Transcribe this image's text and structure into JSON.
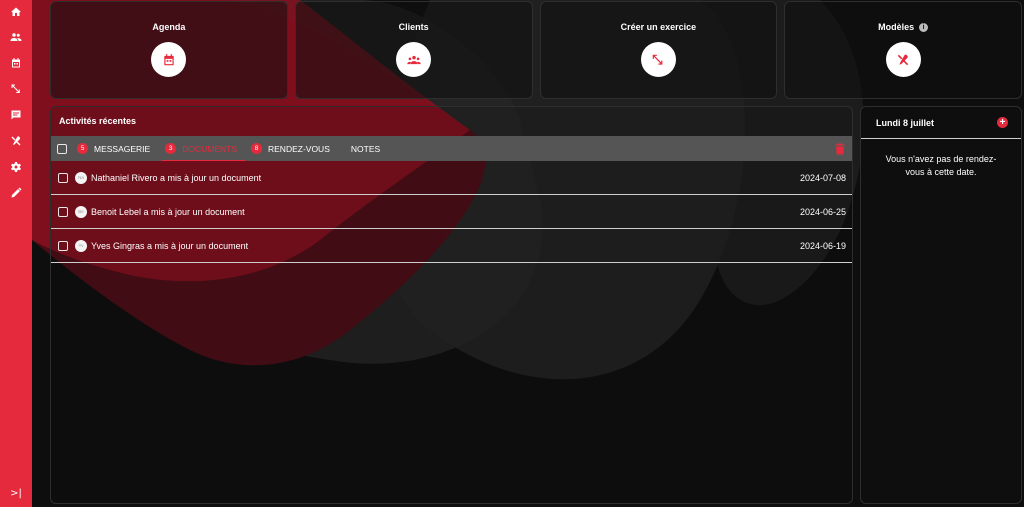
{
  "sidebar": {
    "items": [
      {
        "icon": "home-icon"
      },
      {
        "icon": "users-icon"
      },
      {
        "icon": "calendar-icon"
      },
      {
        "icon": "arrows-icon"
      },
      {
        "icon": "message-icon"
      },
      {
        "icon": "tools-icon"
      },
      {
        "icon": "gear-icon"
      },
      {
        "icon": "pencil-icon"
      }
    ],
    "collapse_label": ">|"
  },
  "cards": [
    {
      "title": "Agenda",
      "icon": "calendar-icon"
    },
    {
      "title": "Clients",
      "icon": "users-icon"
    },
    {
      "title": "Créer un exercice",
      "icon": "arrows-icon"
    },
    {
      "title": "Modèles",
      "icon": "tools-icon",
      "info": "i"
    }
  ],
  "activities": {
    "title": "Activités récentes",
    "tabs": [
      {
        "badge": "5",
        "label": "MESSAGERIE"
      },
      {
        "badge": "3",
        "label": "DOCUMENTS"
      },
      {
        "badge": "8",
        "label": "RENDEZ-VOUS"
      },
      {
        "label": "NOTES"
      }
    ],
    "rows": [
      {
        "avatar": "Na",
        "text": "Nathaniel Rivero a mis à jour un document",
        "date": "2024-07-08"
      },
      {
        "avatar": "Be",
        "text": "Benoit Lebel a mis à jour un document",
        "date": "2024-06-25"
      },
      {
        "avatar": "Yv",
        "text": "Yves Gingras a mis à jour un document",
        "date": "2024-06-19"
      }
    ]
  },
  "calendar": {
    "date_label": "Lundi 8 juillet",
    "add_label": "+",
    "empty_message": "Vous n'avez pas de rendez-vous à cette date."
  },
  "colors": {
    "accent": "#e62a3d",
    "background": "#0e0e0e",
    "tabbar": "#555555"
  }
}
